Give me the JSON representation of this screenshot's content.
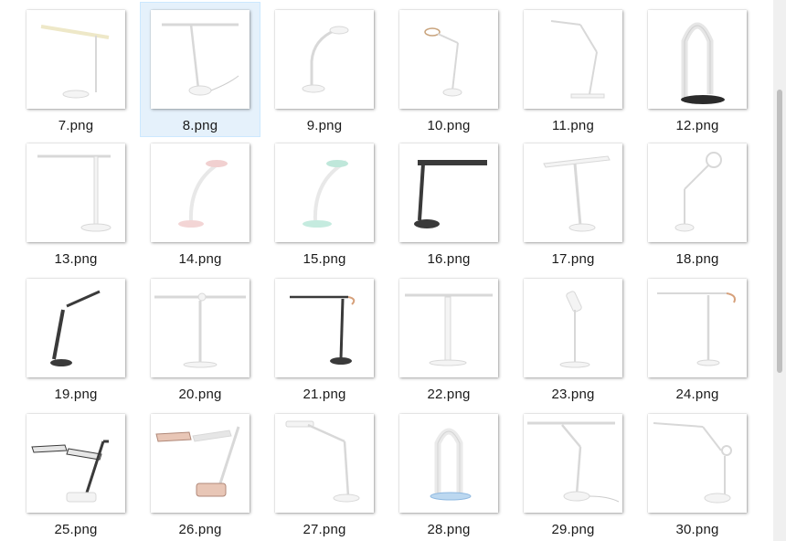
{
  "files": [
    {
      "name": "7.png",
      "lamp": "bar-thin"
    },
    {
      "name": "8.png",
      "lamp": "t-bar",
      "selected": true
    },
    {
      "name": "9.png",
      "lamp": "arc-small"
    },
    {
      "name": "10.png",
      "lamp": "ring-arm"
    },
    {
      "name": "11.png",
      "lamp": "arm-flat"
    },
    {
      "name": "12.png",
      "lamp": "arch-tube"
    },
    {
      "name": "13.png",
      "lamp": "bar-pillar"
    },
    {
      "name": "14.png",
      "lamp": "arc-pink"
    },
    {
      "name": "15.png",
      "lamp": "arc-mint"
    },
    {
      "name": "16.png",
      "lamp": "dark-bar"
    },
    {
      "name": "17.png",
      "lamp": "wing-bar"
    },
    {
      "name": "18.png",
      "lamp": "ring-tall"
    },
    {
      "name": "19.png",
      "lamp": "dark-tilt"
    },
    {
      "name": "20.png",
      "lamp": "t-wide"
    },
    {
      "name": "21.png",
      "lamp": "dark-pole"
    },
    {
      "name": "22.png",
      "lamp": "t-white"
    },
    {
      "name": "23.png",
      "lamp": "spot"
    },
    {
      "name": "24.png",
      "lamp": "pole-copper"
    },
    {
      "name": "25.png",
      "lamp": "double-dark"
    },
    {
      "name": "26.png",
      "lamp": "double-rose"
    },
    {
      "name": "27.png",
      "lamp": "arm-head"
    },
    {
      "name": "28.png",
      "lamp": "arch-blue"
    },
    {
      "name": "29.png",
      "lamp": "bar-cable"
    },
    {
      "name": "30.png",
      "lamp": "arm-joint"
    }
  ]
}
